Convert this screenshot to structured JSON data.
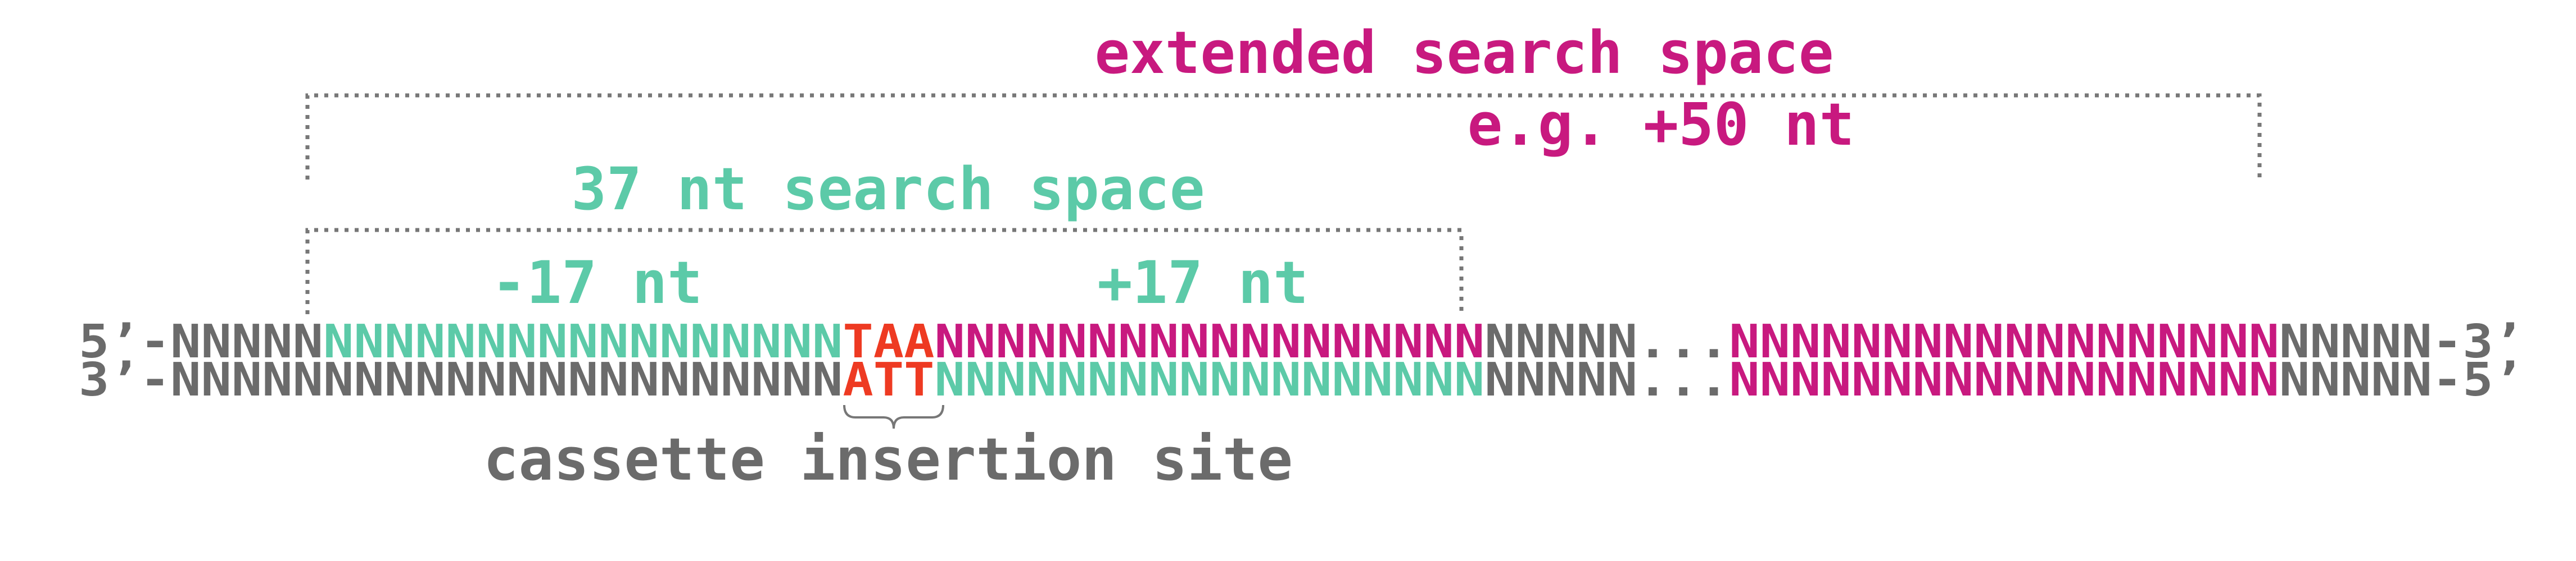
{
  "colors": {
    "grey": "#6b6b6b",
    "teal": "#5ccaa8",
    "magenta": "#c8197f",
    "red": "#ee3a22",
    "bracket": "#777777"
  },
  "labels": {
    "extended_title": "extended search space",
    "extended_sub": "e.g. +50 nt",
    "search_title": "37 nt search space",
    "minus17": "-17 nt",
    "plus17": "+17 nt",
    "insertion": "cassette insertion site"
  },
  "strands": {
    "top": [
      {
        "text": "5’-NNNNN",
        "color": "grey"
      },
      {
        "text": "NNNNNNNNNNNNNNNNN",
        "color": "teal"
      },
      {
        "text": "TAA",
        "color": "red"
      },
      {
        "text": "NNNNNNNNNNNNNNNNNN",
        "color": "magenta"
      },
      {
        "text": "NNNNN...",
        "color": "grey"
      },
      {
        "text": "NNNNNNNNNNNNNNNNNN",
        "color": "magenta"
      },
      {
        "text": "NNNNN-3’",
        "color": "grey"
      }
    ],
    "bottom": [
      {
        "text": "3’-NNNNNNNNNNNNNNNNNNNNNN",
        "color": "grey"
      },
      {
        "text": "ATT",
        "color": "red"
      },
      {
        "text": "NNNNNNNNNNNNNNNNNN",
        "color": "teal"
      },
      {
        "text": "NNNNN...",
        "color": "grey"
      },
      {
        "text": "NNNNNNNNNNNNNNNNNN",
        "color": "magenta"
      },
      {
        "text": "NNNNN-5’",
        "color": "grey"
      }
    ]
  }
}
